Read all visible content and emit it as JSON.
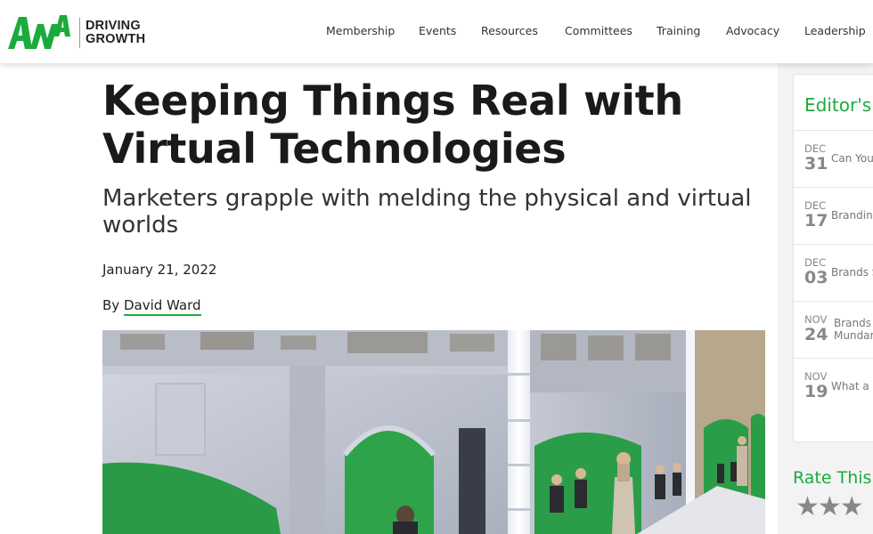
{
  "header": {
    "logo_text": "ANA",
    "tagline_line1": "DRIVING",
    "tagline_line2": "GROWTH",
    "nav": [
      "Membership",
      "Events",
      "Resources",
      "Committees",
      "Training",
      "Advocacy",
      "Leadership"
    ]
  },
  "article": {
    "title": "Keeping Things Real with Virtual Technologies",
    "subtitle": "Marketers grapple with melding the physical and virtual worlds",
    "date": "January 21, 2022",
    "by_label": "By",
    "author": "David Ward"
  },
  "sidebar": {
    "editors_title": "Editor's P",
    "picks": [
      {
        "month": "DEC",
        "day": "31",
        "text1": "Can You",
        "text2": ""
      },
      {
        "month": "DEC",
        "day": "17",
        "text1": "Brandin",
        "text2": ""
      },
      {
        "month": "DEC",
        "day": "03",
        "text1": "Brands S",
        "text2": ""
      },
      {
        "month": "NOV",
        "day": "24",
        "text1": "Brands",
        "text2": "Mundar"
      },
      {
        "month": "NOV",
        "day": "19",
        "text1": "What a",
        "text2": ""
      }
    ],
    "rate_title": "Rate This C",
    "stars": "★★★",
    "rating": 3
  },
  "colors": {
    "brand_green": "#1bab3c",
    "text_dark": "#1a1a1a",
    "sidebar_bg": "#f3f3f3"
  }
}
